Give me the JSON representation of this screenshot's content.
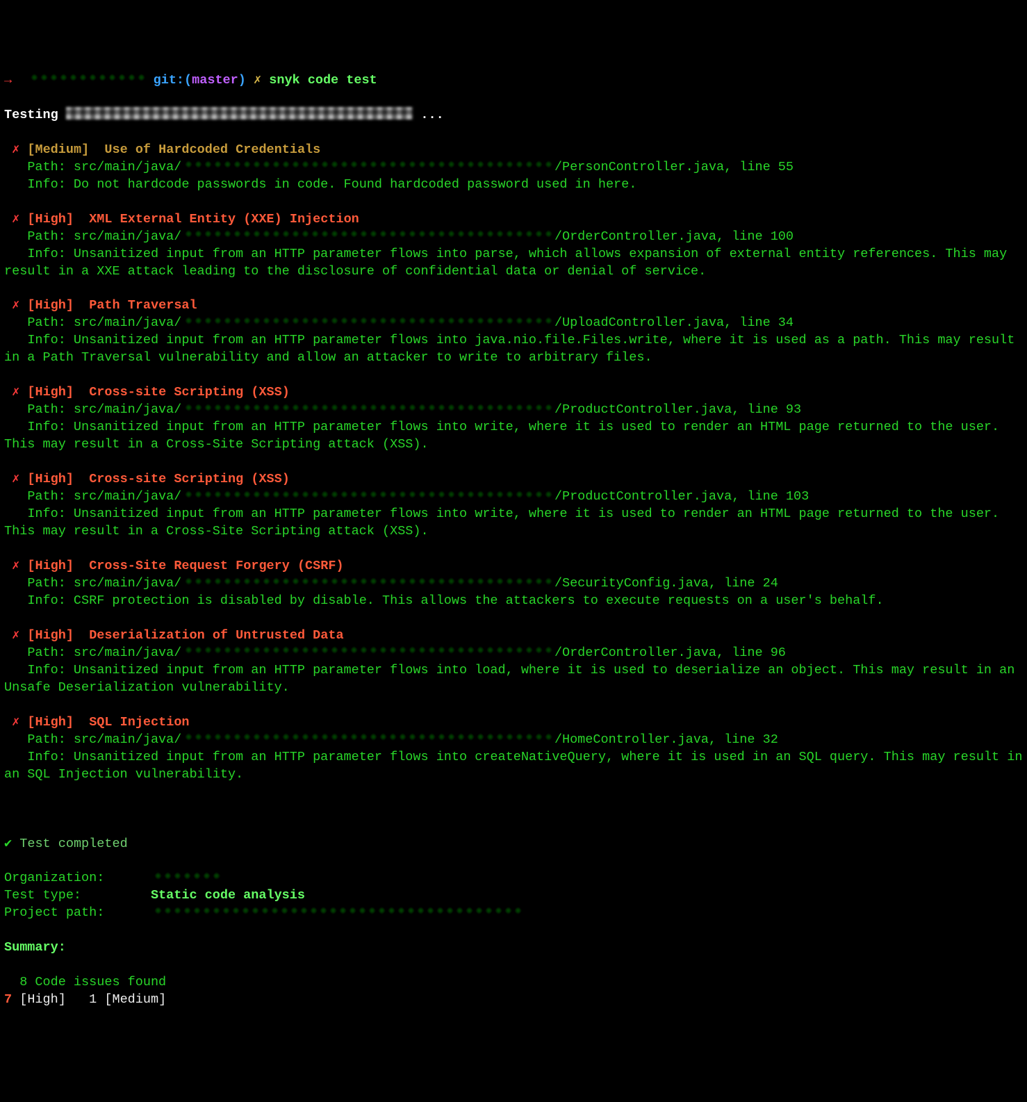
{
  "prompt": {
    "arrow": "→",
    "git_label": "git:(",
    "branch": "master",
    "git_close": ")",
    "lightning": "✗",
    "command": "snyk code test"
  },
  "testing_label": "Testing ",
  "testing_dots": " ...",
  "issues": [
    {
      "severity_label": "[Medium]",
      "severity": "medium",
      "title": "Use of Hardcoded Credentials",
      "path_prefix": "Path: src/main/java/",
      "path_suffix": "/PersonController.java, line 55",
      "info": "Info: Do not hardcode passwords in code. Found hardcoded password used in here."
    },
    {
      "severity_label": "[High]",
      "severity": "high",
      "title": "XML External Entity (XXE) Injection",
      "path_prefix": "Path: src/main/java/",
      "path_suffix": "/OrderController.java, line 100",
      "info": "Info: Unsanitized input from an HTTP parameter flows into parse, which allows expansion of external entity references. This may result in a XXE attack leading to the disclosure of confidential data or denial of service."
    },
    {
      "severity_label": "[High]",
      "severity": "high",
      "title": "Path Traversal",
      "path_prefix": "Path: src/main/java/",
      "path_suffix": "/UploadController.java, line 34",
      "info": "Info: Unsanitized input from an HTTP parameter flows into java.nio.file.Files.write, where it is used as a path. This may result in a Path Traversal vulnerability and allow an attacker to write to arbitrary files."
    },
    {
      "severity_label": "[High]",
      "severity": "high",
      "title": "Cross-site Scripting (XSS)",
      "path_prefix": "Path: src/main/java/",
      "path_suffix": "/ProductController.java, line 93",
      "info": "Info: Unsanitized input from an HTTP parameter flows into write, where it is used to render an HTML page returned to the user. This may result in a Cross-Site Scripting attack (XSS)."
    },
    {
      "severity_label": "[High]",
      "severity": "high",
      "title": "Cross-site Scripting (XSS)",
      "path_prefix": "Path: src/main/java/",
      "path_suffix": "/ProductController.java, line 103",
      "info": "Info: Unsanitized input from an HTTP parameter flows into write, where it is used to render an HTML page returned to the user. This may result in a Cross-Site Scripting attack (XSS)."
    },
    {
      "severity_label": "[High]",
      "severity": "high",
      "title": "Cross-Site Request Forgery (CSRF)",
      "path_prefix": "Path: src/main/java/",
      "path_suffix": "/SecurityConfig.java, line 24",
      "info": "Info: CSRF protection is disabled by disable. This allows the attackers to execute requests on a user's behalf."
    },
    {
      "severity_label": "[High]",
      "severity": "high",
      "title": "Deserialization of Untrusted Data",
      "path_prefix": "Path: src/main/java/",
      "path_suffix": "/OrderController.java, line 96",
      "info": "Info: Unsanitized input from an HTTP parameter flows into load, where it is used to deserialize an object. This may result in an Unsafe Deserialization vulnerability."
    },
    {
      "severity_label": "[High]",
      "severity": "high",
      "title": "SQL Injection",
      "path_prefix": "Path: src/main/java/",
      "path_suffix": "/HomeController.java, line 32",
      "info": "Info: Unsanitized input from an HTTP parameter flows into createNativeQuery, where it is used in an SQL query. This may result in an SQL Injection vulnerability."
    }
  ],
  "cross_sym": "✗",
  "completed_symbol": "✔",
  "completed_text": " Test completed",
  "meta": {
    "org_label": "Organization:      ",
    "type_label": "Test type:         ",
    "type_value": "Static code analysis",
    "path_label": "Project path:      "
  },
  "summary": {
    "label": "Summary:",
    "issues_line": "  8 Code issues found",
    "high_count": "7 ",
    "high_label": "[High]",
    "sep": "   ",
    "med_count": "1 ",
    "med_label": "[Medium]"
  }
}
